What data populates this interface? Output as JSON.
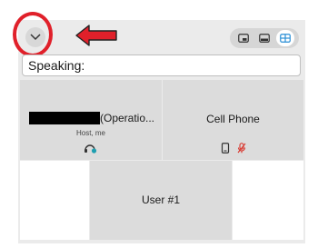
{
  "header": {
    "collapse_icon": "chevron-down-icon",
    "annotation_color": "#e0202a",
    "view_modes": [
      "picture-in-picture-icon",
      "filmstrip-icon",
      "grid-icon"
    ],
    "active_view": "grid-icon",
    "accent": "#2a8fd6"
  },
  "speaking": {
    "label": "Speaking:"
  },
  "participants": [
    {
      "name_suffix": "(Operatio...",
      "role": "Host, me",
      "icons": [
        "host-headset-icon"
      ]
    },
    {
      "name": "Cell Phone",
      "icons": [
        "phone-icon",
        "microphone-muted-icon"
      ]
    },
    {
      "name": "User #1",
      "icons": []
    }
  ]
}
